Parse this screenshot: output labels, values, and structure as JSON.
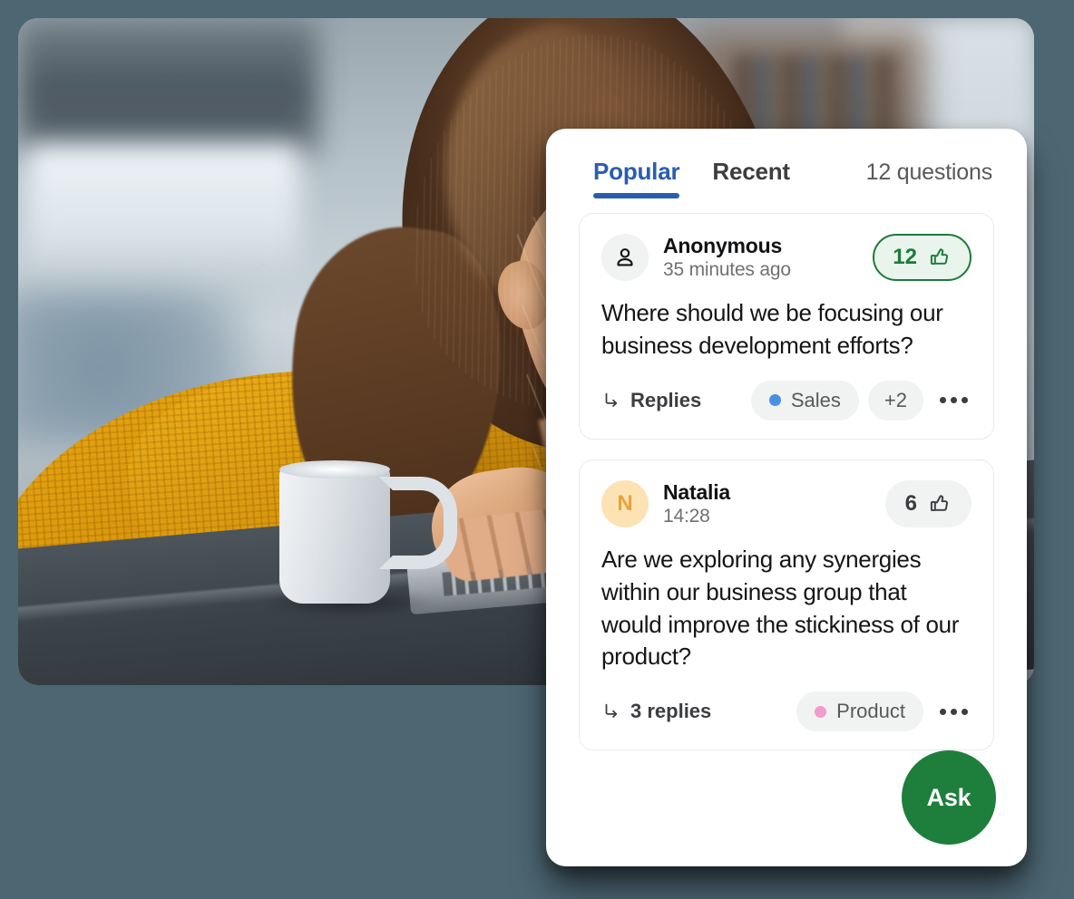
{
  "theme": {
    "page_background": "#4c6672",
    "accent_blue": "#2a5db0",
    "accent_green": "#1d7f3b",
    "vote_green": "#1d7a39",
    "vote_green_bg": "#e9f4ec",
    "chip_gray": "#f1f2f2"
  },
  "photo": {
    "alt": "Woman in yellow sweater smiling at a laptop with a mug on the desk"
  },
  "panel": {
    "tabs": [
      {
        "label": "Popular",
        "active": true
      },
      {
        "label": "Recent",
        "active": false
      }
    ],
    "question_count_label": "12 questions",
    "ask_button_label": "Ask",
    "questions": [
      {
        "author": "Anonymous",
        "avatar_type": "person-icon",
        "avatar_initial": "",
        "timestamp": "35 minutes ago",
        "votes": "12",
        "voted": true,
        "text": "Where should we be focusing our business development efforts?",
        "replies_label": "Replies",
        "tags": [
          {
            "label": "Sales",
            "color": "#4a90e2"
          }
        ],
        "extra_tags_label": "+2"
      },
      {
        "author": "Natalia",
        "avatar_type": "initial",
        "avatar_initial": "N",
        "timestamp": "14:28",
        "votes": "6",
        "voted": false,
        "text": "Are we exploring any synergies within our business group that would improve the stickiness of our product?",
        "replies_label": "3 replies",
        "tags": [
          {
            "label": "Product",
            "color": "#f19ccd"
          }
        ],
        "extra_tags_label": ""
      }
    ]
  }
}
